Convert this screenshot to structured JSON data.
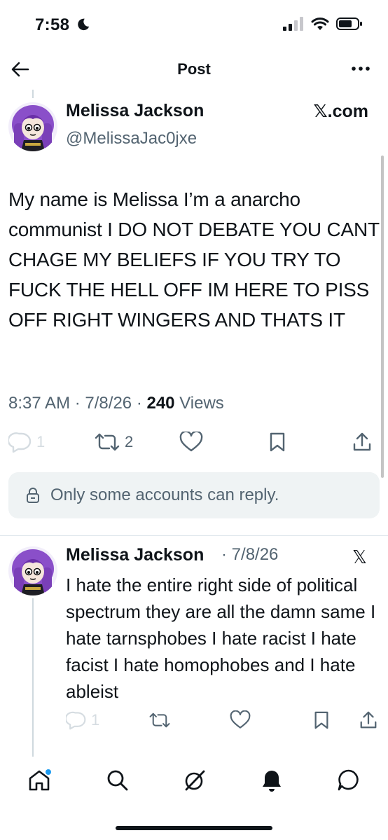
{
  "status_bar": {
    "time": "7:58"
  },
  "nav": {
    "title": "Post"
  },
  "post": {
    "author_name": "Melissa Jackson",
    "author_handle": "@MelissaJac0jxe",
    "via": "𝕏.com",
    "text": "My name is Melissa I’m a anarcho communist I DO NOT DEBATE YOU CANT CHAGE MY BELIEFS IF YOU TRY TO FUCK THE HELL OFF IM HERE TO PISS OFF RIGHT WINGERS AND THATS IT",
    "time": "8:37 AM",
    "date": "7/8/26",
    "views_count": "240",
    "views_label": "Views",
    "reply_count": "1",
    "repost_count": "2",
    "reply_notice": "Only some accounts can reply."
  },
  "reply": {
    "author_name": "Melissa Jackson",
    "date": "7/8/26",
    "via": "𝕏",
    "text": "I hate the entire right side of political spectrum they are all the damn same I hate tarnsphobes I hate racist I hate facist I hate homophobes and I hate ableist",
    "reply_count": "1"
  },
  "colors": {
    "accent": "#1d9bf0",
    "secondary_text": "#536471",
    "text": "#0f1419"
  },
  "icons": [
    "moon-icon",
    "signal-icon",
    "wifi-icon",
    "battery-icon",
    "back-arrow-icon",
    "more-icon",
    "reply-icon",
    "repost-icon",
    "like-icon",
    "bookmark-icon",
    "share-icon",
    "lock-icon",
    "home-icon",
    "search-icon",
    "grok-icon",
    "notifications-icon",
    "messages-icon"
  ]
}
